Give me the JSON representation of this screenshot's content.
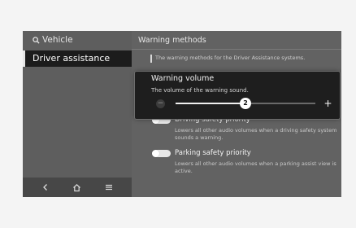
{
  "left_pane": {
    "back_label": "Vehicle",
    "back_icon": "search-icon",
    "selected_item": "Driver assistance"
  },
  "bottom_bar": {
    "icons": [
      "back-chevron-icon",
      "home-icon",
      "menu-icon"
    ],
    "glyphs": [
      "‹",
      "⌂",
      "≡"
    ]
  },
  "right_pane": {
    "title": "Warning methods",
    "description": "The warning methods for the Driver Assistance systems.",
    "options": [
      {
        "label": "Driving safety priority",
        "description": "Lowers all other audio volumes when a driving safety system sounds a warning.",
        "enabled": false
      },
      {
        "label": "Parking safety priority",
        "description": "Lowers all other audio volumes when a parking assist view is active.",
        "enabled": false
      }
    ]
  },
  "volume_popup": {
    "title": "Warning volume",
    "description": "The volume of the warning sound.",
    "value": "2",
    "minus": "−",
    "plus": "+",
    "level_fraction": 0.5
  },
  "colors": {
    "screen_bg": "#626262",
    "selected_bg": "#1c1c1c",
    "popup_bg": "#1e1e1e",
    "page_bg": "#f4f4f4"
  }
}
